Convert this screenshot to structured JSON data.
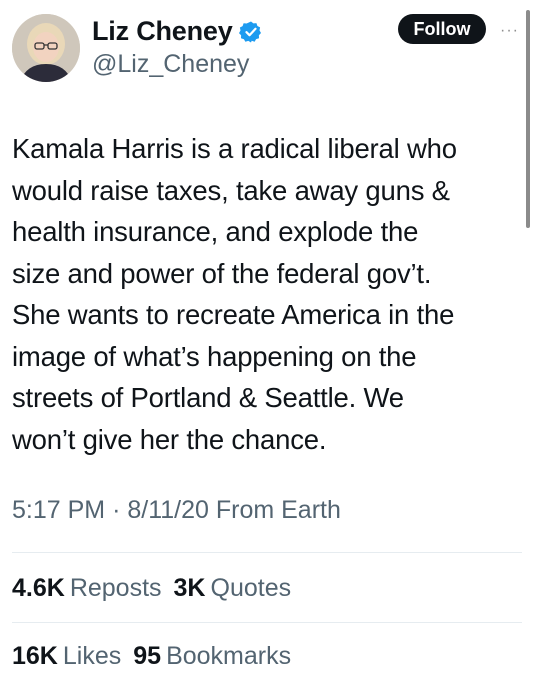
{
  "tweet": {
    "author_name": "Liz Cheney",
    "handle": "@Liz_Cheney",
    "follow_label": "Follow",
    "more_label": "···",
    "text": "Kamala Harris is a radical liberal who\nwould raise taxes, take away guns &\nhealth insurance, and explode the\nsize and power of the federal gov’t.\nShe wants to recreate America in the\nimage of what’s happening on the\nstreets of Portland & Seattle. We\nwon’t give her the chance.",
    "time": "5:17 PM",
    "separator": "·",
    "date": "8/11/20",
    "source": "From Earth"
  },
  "stats": {
    "reposts_count": "4.6K",
    "reposts_label": "Reposts",
    "quotes_count": "3K",
    "quotes_label": "Quotes",
    "likes_count": "16K",
    "likes_label": "Likes",
    "bookmarks_count": "95",
    "bookmarks_label": "Bookmarks"
  },
  "icons": {
    "verified": "verified-badge-icon",
    "more": "more-options-icon"
  },
  "colors": {
    "verified_blue": "#1d9bf0",
    "follow_button_bg": "#0f1419",
    "secondary_text": "#536471"
  }
}
